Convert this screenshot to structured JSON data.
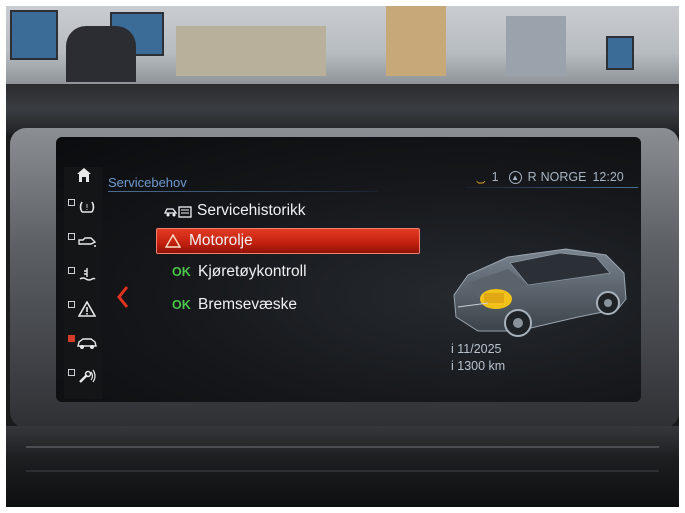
{
  "screen": {
    "title": "Servicebehov",
    "status": {
      "car_count": "1",
      "radio_mode": "R",
      "station": "NORGE",
      "time": "12:20"
    },
    "menu": [
      {
        "badge": "",
        "icon": "service-history-icon",
        "label": "Servicehistorikk",
        "selected": false
      },
      {
        "badge": "warning",
        "icon": "warning-triangle-icon",
        "label": "Motorolje",
        "selected": true
      },
      {
        "badge": "OK",
        "icon": "",
        "label": "Kjøretøykontroll",
        "selected": false
      },
      {
        "badge": "OK",
        "icon": "",
        "label": "Bremsevæske",
        "selected": false
      }
    ],
    "side_rail": [
      {
        "icon": "home-icon"
      },
      {
        "icon": "tire-pressure-icon"
      },
      {
        "icon": "oil-can-icon"
      },
      {
        "icon": "coolant-icon"
      },
      {
        "icon": "warning-triangle-icon"
      },
      {
        "icon": "car-service-icon",
        "checked": true
      },
      {
        "icon": "wrench-phone-icon"
      }
    ],
    "info": {
      "due_date": "i 11/2025",
      "due_distance": "i 1300 km"
    },
    "colors": {
      "accent_blue": "#6d9bd0",
      "selection_red": "#d42a16",
      "ok_green": "#4bc44b",
      "engine_highlight": "#f2c21a"
    }
  }
}
